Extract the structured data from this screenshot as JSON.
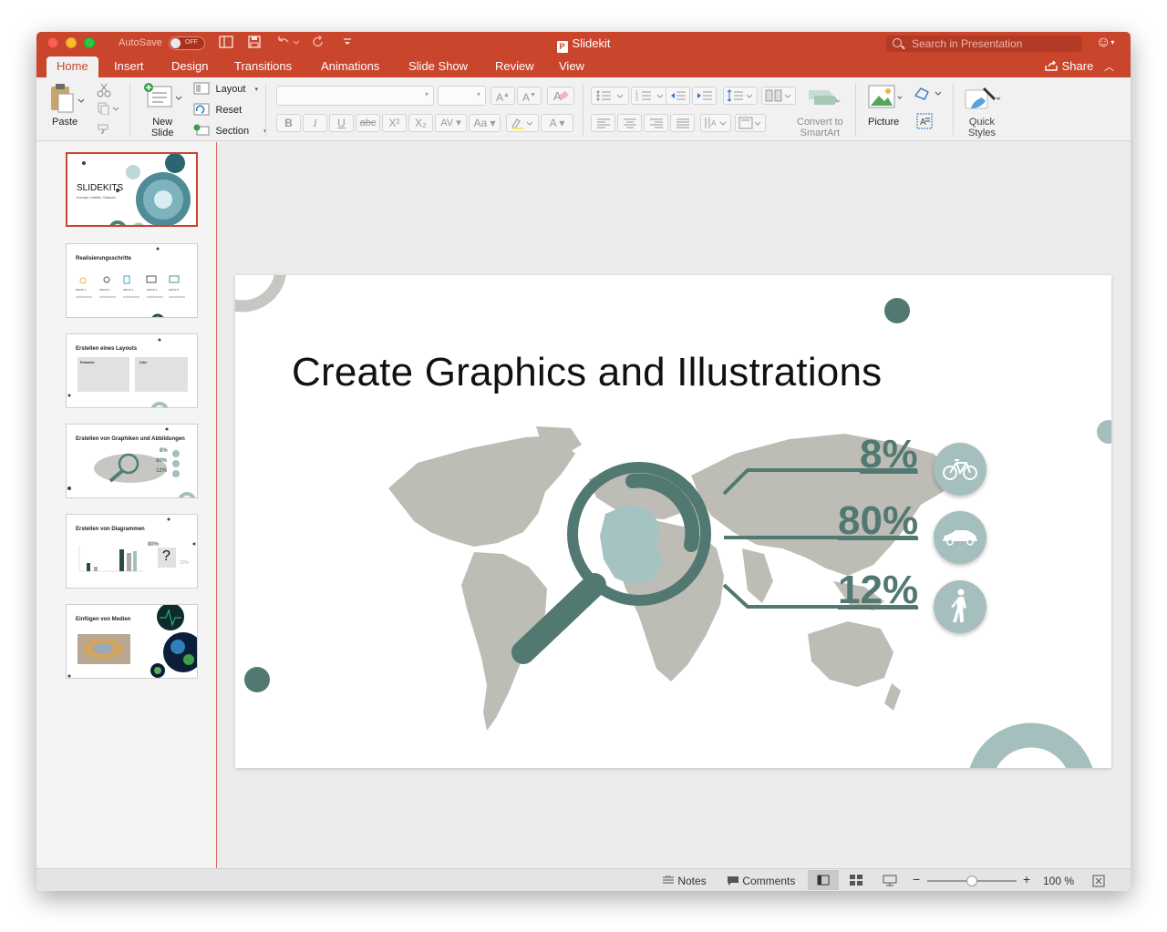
{
  "titlebar": {
    "autosave_label": "AutoSave",
    "autosave_state": "OFF",
    "doc_title": "Slidekit",
    "doc_icon_letter": "P",
    "search_placeholder": "Search in Presentation"
  },
  "tabs": [
    {
      "label": "Home",
      "active": true
    },
    {
      "label": "Insert"
    },
    {
      "label": "Design"
    },
    {
      "label": "Transitions"
    },
    {
      "label": "Animations"
    },
    {
      "label": "Slide Show"
    },
    {
      "label": "Review"
    },
    {
      "label": "View"
    }
  ],
  "share_label": "Share",
  "ribbon": {
    "paste": "Paste",
    "new_slide_1": "New",
    "new_slide_2": "Slide",
    "layout": "Layout",
    "reset": "Reset",
    "section": "Section",
    "bold": "B",
    "italic": "I",
    "underline": "U",
    "strike": "abc",
    "superscript": "X²",
    "subscript": "X₂",
    "char_spacing": "AV",
    "change_case": "Aa",
    "font_color": "A",
    "grow_font": "A",
    "shrink_font": "A",
    "convert_smartart_1": "Convert to",
    "convert_smartart_2": "SmartArt",
    "picture": "Picture",
    "quick_styles_1": "Quick",
    "quick_styles_2": "Styles"
  },
  "thumbnails": [
    {
      "title": "SLIDEKITS",
      "subtitle": "Konzept, ersteller, Tatsache",
      "selected": true
    },
    {
      "title": "Realisierungsschritte",
      "steps": [
        "Schritt 1",
        "Schritt 2",
        "Schritt 3",
        "Schritt 4",
        "Schritt 5"
      ]
    },
    {
      "title": "Erstellen eines Layouts",
      "box1": "Entweder",
      "box2": "Oder"
    },
    {
      "title": "Erstellen von Graphiken und Abbildungen",
      "values": [
        "8%",
        "80%",
        "12%"
      ]
    },
    {
      "title": "Erstellen von Diagrammen",
      "value_top": "80%",
      "value_side": "20%",
      "mark": "?"
    },
    {
      "title": "Einfügen von Medien"
    }
  ],
  "slide": {
    "title": "Create Graphics and Illustrations",
    "stats": [
      {
        "value": "8%",
        "icon": "bicycle-icon"
      },
      {
        "value": "80%",
        "icon": "car-icon"
      },
      {
        "value": "12%",
        "icon": "pedestrian-icon"
      }
    ],
    "accent_color": "#527872",
    "light_accent": "#a5bfbe"
  },
  "statusbar": {
    "notes": "Notes",
    "comments": "Comments",
    "zoom": "100 %",
    "zoom_fraction": 0.5
  }
}
